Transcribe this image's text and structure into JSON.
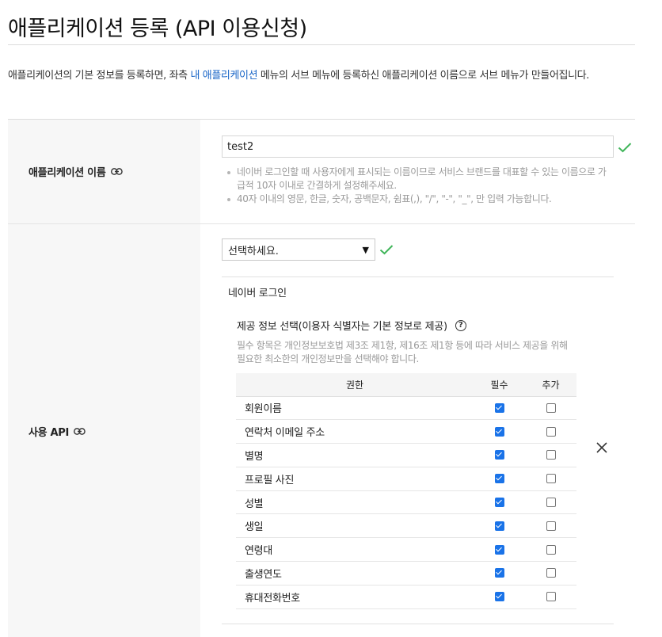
{
  "page": {
    "title": "애플리케이션 등록 (API 이용신청)",
    "description_before": "애플리케이션의 기본 정보를 등록하면, 좌측 ",
    "description_link": "내 애플리케이션",
    "description_after": " 메뉴의 서브 메뉴에 등록하신 애플리케이션 이름으로 서브 메뉴가 만들어집니다."
  },
  "app_name": {
    "label": "애플리케이션 이름",
    "value": "test2",
    "hints": [
      "네이버 로그인할 때 사용자에게 표시되는 이름이므로 서비스 브랜드를 대표할 수 있는 이름으로 가급적 10자 이내로 간결하게 설정해주세요.",
      "40자 이내의 영문, 한글, 숫자, 공백문자, 쉼표(,), \"/\", \"-\", \"_\", 만 입력 가능합니다."
    ]
  },
  "api": {
    "label": "사용 API",
    "select_value": "선택하세요.",
    "selected_api": "네이버 로그인",
    "info_title": "제공 정보 선택(이용자 식별자는 기본 정보로 제공)",
    "info_note": "필수 항목은 개인정보보호법 제3조 제1항, 제16조 제1항 등에 따라 서비스 제공을 위해 필요한 최소한의 개인정보만을 선택해야 합니다.",
    "columns": [
      "권한",
      "필수",
      "추가"
    ],
    "permissions": [
      {
        "name": "회원이름",
        "required": true,
        "extra": false
      },
      {
        "name": "연락처 이메일 주소",
        "required": true,
        "extra": false
      },
      {
        "name": "별명",
        "required": true,
        "extra": false
      },
      {
        "name": "프로필 사진",
        "required": true,
        "extra": false
      },
      {
        "name": "성별",
        "required": true,
        "extra": false
      },
      {
        "name": "생일",
        "required": true,
        "extra": false
      },
      {
        "name": "연령대",
        "required": true,
        "extra": false
      },
      {
        "name": "출생연도",
        "required": true,
        "extra": false
      },
      {
        "name": "휴대전화번호",
        "required": true,
        "extra": false
      }
    ]
  },
  "colors": {
    "accent": "#1a73e8",
    "link": "#1a66c7",
    "valid_check": "#3fb559"
  }
}
